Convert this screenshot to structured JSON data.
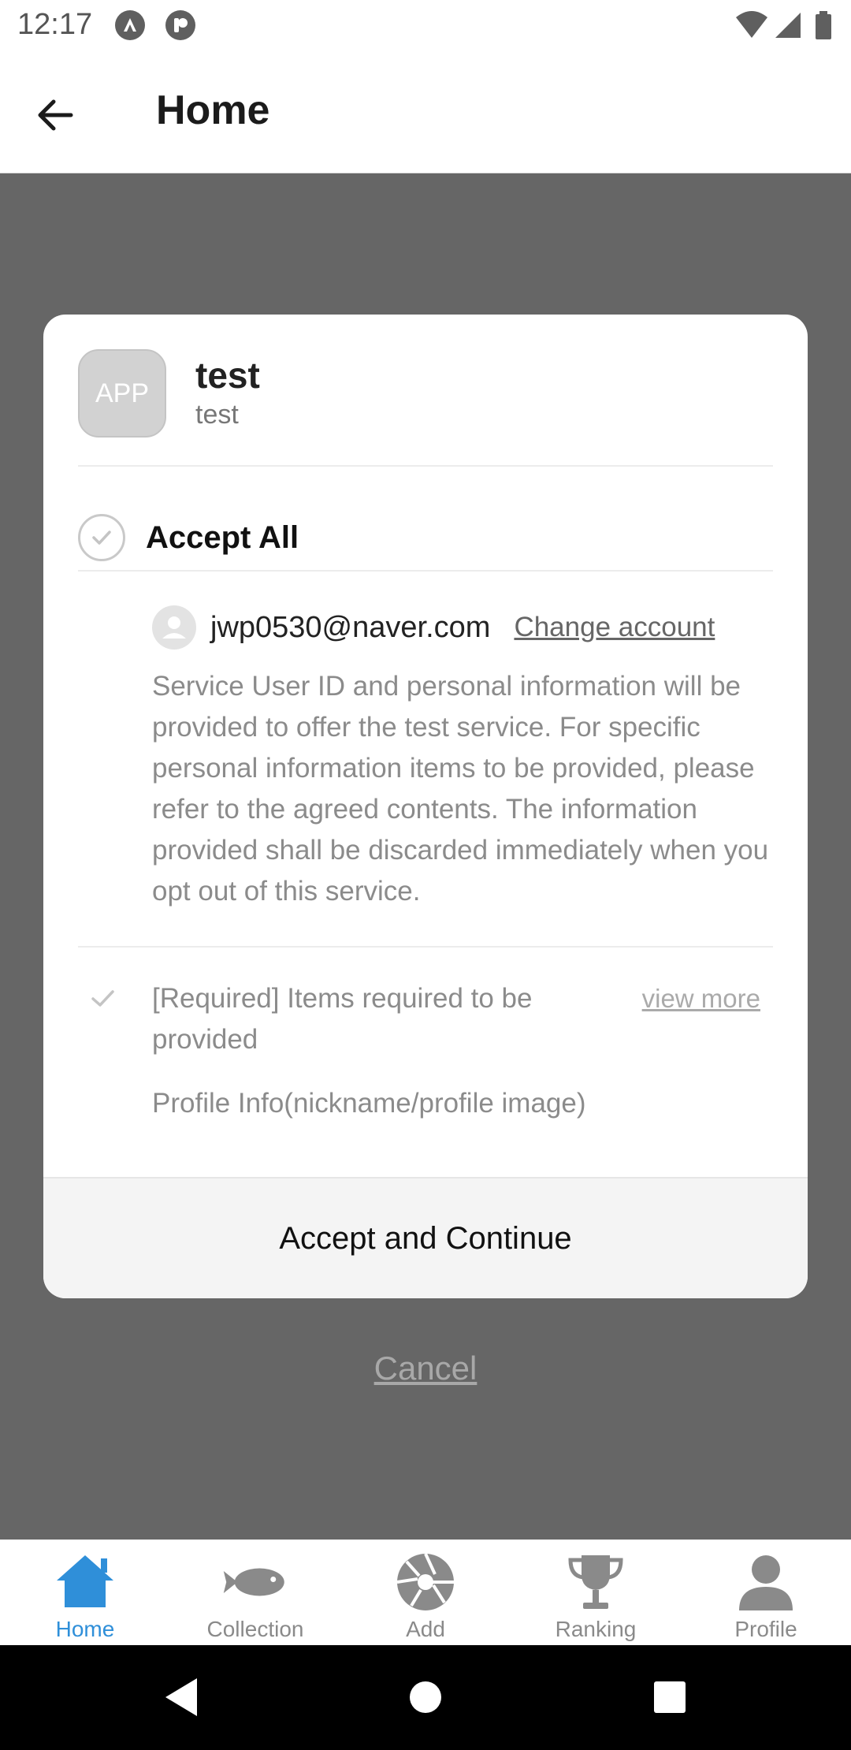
{
  "status_bar": {
    "time": "12:17",
    "left_icons": [
      "app-notification-icon",
      "app-notification-icon-2"
    ],
    "right_icons": [
      "wifi-icon",
      "signal-icon",
      "battery-icon"
    ]
  },
  "app_bar": {
    "title": "Home",
    "back_icon": "back-arrow-icon"
  },
  "dialog": {
    "app": {
      "avatar_text": "APP",
      "name": "test",
      "subtitle": "test"
    },
    "accept_all_label": "Accept All",
    "account": {
      "email": "jwp0530@naver.com",
      "change_account_label": "Change account"
    },
    "description": "Service User ID and personal information will be provided to offer the test service. For specific personal information items to be provided, please refer to the agreed contents. The information provided shall be discarded immediately when you opt out of this service.",
    "required_item": {
      "label": "[Required] Items required to be provided",
      "view_more_label": "view more",
      "detail": "Profile Info(nickname/profile image)"
    },
    "accept_button_label": "Accept and Continue"
  },
  "cancel_label": "Cancel",
  "bottom_nav": {
    "active_color": "#2f8fd9",
    "items": [
      {
        "label": "Home",
        "icon": "home-icon",
        "active": true
      },
      {
        "label": "Collection",
        "icon": "fish-icon",
        "active": false
      },
      {
        "label": "Add",
        "icon": "camera-aperture-icon",
        "active": false
      },
      {
        "label": "Ranking",
        "icon": "trophy-icon",
        "active": false
      },
      {
        "label": "Profile",
        "icon": "person-icon",
        "active": false
      }
    ]
  }
}
